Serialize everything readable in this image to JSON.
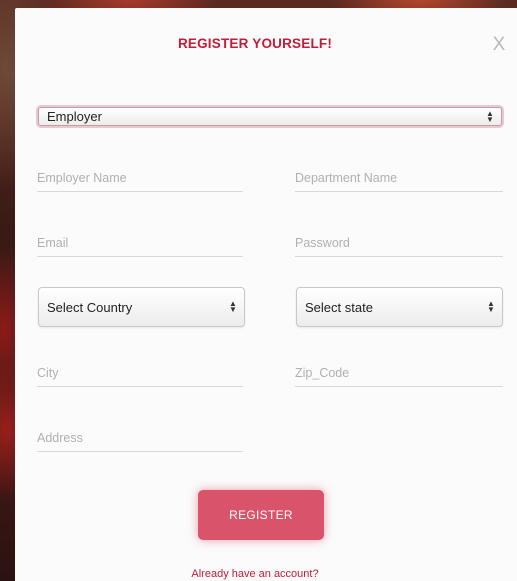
{
  "modal": {
    "title": "REGISTER YOURSELF!",
    "close_label": "X"
  },
  "form": {
    "role_select": {
      "value": "Employer"
    },
    "employer_name": {
      "placeholder": "Employer Name"
    },
    "department_name": {
      "placeholder": "Department Name"
    },
    "email": {
      "placeholder": "Email"
    },
    "password": {
      "placeholder": "Password"
    },
    "country_select": {
      "value": "Select Country"
    },
    "state_select": {
      "value": "Select state"
    },
    "city": {
      "placeholder": "City"
    },
    "zip_code": {
      "placeholder": "Zip_Code"
    },
    "address": {
      "placeholder": "Address"
    },
    "register_label": "REGISTER",
    "login_link": "Already have an account?"
  },
  "colors": {
    "accent": "#c21d3a",
    "button": "#d9546a",
    "modal_background": "#fbfbfb"
  },
  "icons": {
    "select_arrow": "chevron-up-down-icon",
    "close": "close-icon"
  }
}
